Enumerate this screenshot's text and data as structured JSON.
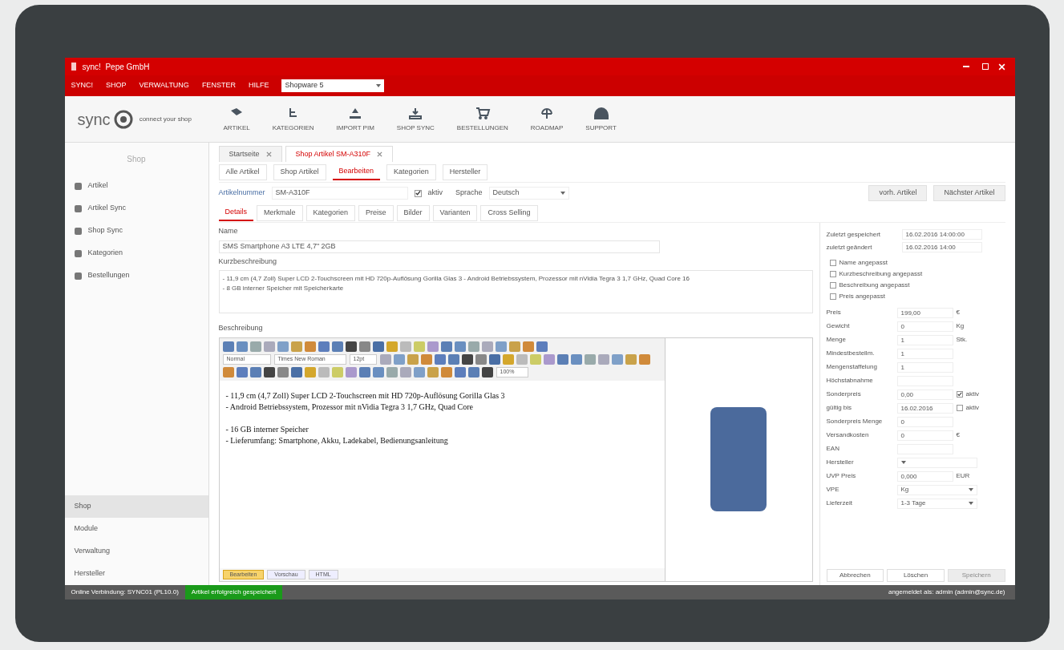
{
  "window": {
    "title": "sync!  Pepe GmbH"
  },
  "menu": [
    "SYNC!",
    "SHOP",
    "VERWALTUNG",
    "FENSTER",
    "HILFE"
  ],
  "shop_select": {
    "value": "Shopware 5"
  },
  "logo": {
    "word": "sync",
    "tagline": "connect your shop"
  },
  "toolbar": [
    "ARTIKEL",
    "KATEGORIEN",
    "IMPORT PIM",
    "SHOP SYNC",
    "BESTELLUNGEN",
    "ROADMAP",
    "SUPPORT"
  ],
  "sidebar": {
    "header": "Shop",
    "items": [
      "Artikel",
      "Artikel Sync",
      "Shop Sync",
      "Kategorien",
      "Bestellungen"
    ],
    "sections": [
      {
        "label": "Shop",
        "selected": true
      },
      {
        "label": "Module",
        "selected": false
      },
      {
        "label": "Verwaltung",
        "selected": false
      },
      {
        "label": "Hersteller",
        "selected": false
      }
    ]
  },
  "doc_tabs": [
    {
      "label": "Startseite",
      "selected": false
    },
    {
      "label": "Shop Artikel SM-A310F",
      "selected": true
    }
  ],
  "sub_tabs": [
    {
      "label": "Alle Artikel",
      "selected": false
    },
    {
      "label": "Shop Artikel",
      "selected": false
    },
    {
      "label": "Bearbeiten",
      "selected": true
    },
    {
      "label": "Kategorien",
      "selected": false
    },
    {
      "label": "Hersteller",
      "selected": false
    }
  ],
  "article": {
    "label": "Artikelnummer",
    "value": "SM-A310F",
    "active": {
      "label": "aktiv",
      "checked": true
    },
    "language_label": "Sprache",
    "language": "Deutsch"
  },
  "actions": [
    "vorh. Artikel",
    "Nächster Artikel"
  ],
  "detail_tabs": [
    {
      "label": "Details",
      "selected": true
    },
    {
      "label": "Merkmale",
      "selected": false
    },
    {
      "label": "Kategorien",
      "selected": false
    },
    {
      "label": "Preise",
      "selected": false
    },
    {
      "label": "Bilder",
      "selected": false
    },
    {
      "label": "Varianten",
      "selected": false
    },
    {
      "label": "Cross Selling",
      "selected": false
    }
  ],
  "name": {
    "label": "Name",
    "value": "SMS Smartphone A3 LTE 4,7\" 2GB"
  },
  "short_description": {
    "label": "Kurzbeschreibung",
    "lines": [
      "- 11,9 cm (4,7 Zoll) Super LCD 2-Touchscreen mit HD 720p-Auflösung Gorilla Glas 3 - Android Betriebssystem, Prozessor mit nVidia Tegra 3 1,7 GHz, Quad Core 16",
      "- 8 GB interner Speicher mit Speicherkarte"
    ]
  },
  "description": {
    "label": "Beschreibung",
    "format": "Normal",
    "font": "Times New Roman",
    "size": "12pt",
    "zoom": "100%",
    "paragraphs": [
      [
        "- 11,9 cm (4,7 Zoll) Super LCD 2-Touchscreen mit HD 720p-Auflösung Gorilla Glas 3",
        "- Android Betriebssystem, Prozessor mit nVidia Tegra 3 1,7 GHz, Quad Core"
      ],
      [
        "- 16 GB interner Speicher",
        "- Lieferumfang: Smartphone, Akku, Ladekabel, Bedienungsanleitung"
      ]
    ],
    "modes": [
      {
        "label": "Bearbeiten",
        "selected": true
      },
      {
        "label": "Vorschau",
        "selected": false
      },
      {
        "label": "HTML",
        "selected": false
      }
    ]
  },
  "panel": {
    "saved": {
      "label": "Zuletzt gespeichert",
      "value": "16.02.2016 14:00:00"
    },
    "changed": {
      "label": "zuletzt geändert",
      "value": "16.02.2016 14:00"
    },
    "flags": [
      {
        "label": "Name angepasst",
        "checked": false
      },
      {
        "label": "Kurzbeschreibung angepasst",
        "checked": false
      },
      {
        "label": "Beschreibung angepasst",
        "checked": false
      },
      {
        "label": "Preis angepasst",
        "checked": false
      }
    ],
    "fields": [
      {
        "kind": "text",
        "label": "Preis",
        "value": "199,00",
        "unit": "€"
      },
      {
        "kind": "text",
        "label": "Gewicht",
        "value": "0",
        "unit": "Kg"
      },
      {
        "kind": "text",
        "label": "Menge",
        "value": "1",
        "unit": "Stk."
      },
      {
        "kind": "text",
        "label": "Mindestbestellm.",
        "value": "1"
      },
      {
        "kind": "text",
        "label": "Mengenstaffelung",
        "value": "1"
      },
      {
        "kind": "text",
        "label": "Höchstabnahme"
      },
      {
        "kind": "check",
        "label": "Sonderpreis",
        "value": "0,00",
        "check": "aktiv",
        "checked": true
      },
      {
        "kind": "check",
        "label": "gültig bis",
        "value": "16.02.2016",
        "check": "aktiv",
        "checked": false
      },
      {
        "kind": "text",
        "label": "Sonderpreis Menge",
        "value": "0"
      },
      {
        "kind": "text",
        "label": "Versandkosten",
        "value": "0",
        "unit": "€"
      },
      {
        "kind": "text",
        "label": "EAN"
      },
      {
        "kind": "select",
        "label": "Hersteller"
      },
      {
        "kind": "text",
        "label": "UVP Preis",
        "value": "0,000",
        "unit": "EUR"
      },
      {
        "kind": "select",
        "label": "VPE",
        "value": "Kg"
      },
      {
        "kind": "select",
        "label": "Lieferzeit",
        "value": "1-3 Tage"
      }
    ],
    "buttons": [
      {
        "label": "Abbrechen",
        "disabled": false
      },
      {
        "label": "Löschen",
        "disabled": false
      },
      {
        "label": "Speichern",
        "disabled": true
      }
    ]
  },
  "status_bar": {
    "connection": "Online Verbindung: SYNC01 (PL10.0)",
    "message": "Artikel erfolgreich gespeichert",
    "user": "angemeldet als: admin (admin@sync.de)"
  }
}
